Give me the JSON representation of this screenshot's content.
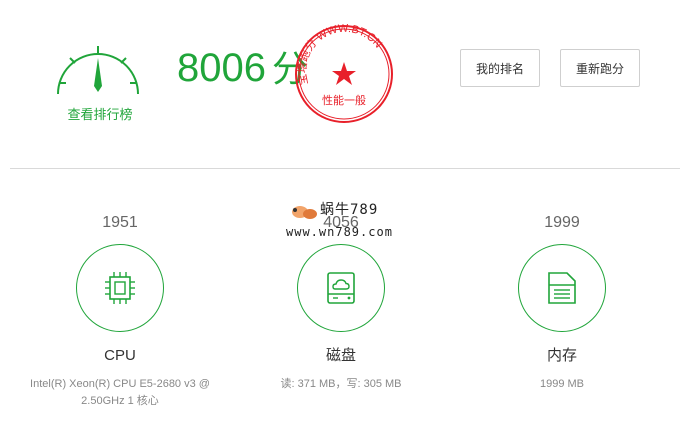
{
  "header": {
    "rank_link": "查看排行榜",
    "score_value": "8006",
    "score_unit": "分",
    "my_rank_button": "我的排名",
    "rerun_button": "重新跑分"
  },
  "stamp": {
    "top_text": "宝塔跑分 WWW.BT.CN",
    "bottom_text": "性能一般"
  },
  "watermark": {
    "line1": "蜗牛789",
    "line2": "www.wn789.com"
  },
  "cards": {
    "cpu": {
      "value": "1951",
      "label": "CPU",
      "detail": "Intel(R) Xeon(R) CPU E5-2680 v3 @ 2.50GHz 1 核心"
    },
    "disk": {
      "value": "4056",
      "label": "磁盘",
      "detail": "读: 371 MB，写: 305 MB"
    },
    "memory": {
      "value": "1999",
      "label": "内存",
      "detail": "1999 MB"
    }
  },
  "colors": {
    "accent": "#20a53a",
    "stamp": "#e8202a"
  },
  "icons": {
    "cpu": "chip-icon",
    "disk": "cloud-drive-icon",
    "memory": "memory-card-icon",
    "gauge": "gauge-icon"
  }
}
